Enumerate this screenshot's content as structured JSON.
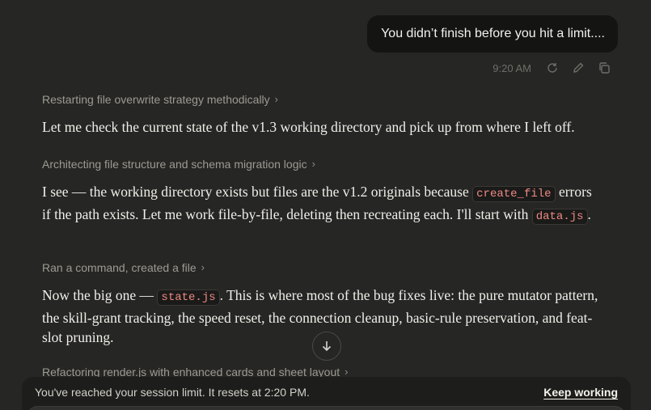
{
  "user_message": {
    "text": "You didn’t finish before you hit a limit....",
    "time": "9:20 AM",
    "actions": [
      "retry-icon",
      "edit-icon",
      "copy-icon"
    ]
  },
  "assistant": {
    "thought_1": "Restarting file overwrite strategy methodically",
    "para_1": "Let me check the current state of the v1.3 working directory and pick up from where I left off.",
    "thought_2": "Architecting file structure and schema migration logic",
    "para_2": {
      "a": "I see — the working directory exists but files are the v1.2 originals because ",
      "code1": "create_file",
      "b": " errors if the path exists. Let me work file-by-file, deleting then recreating each. I'll start with ",
      "code2": "data.js",
      "c": "."
    },
    "thought_3": "Ran a command, created a file",
    "para_3": {
      "a": "Now the big one — ",
      "code1": "state.js",
      "b": ". This is where most of the bug fixes live: the pure mutator pattern, the skill-grant tracking, the speed reset, the connection cleanup, basic-rule preservation, and feat-slot pruning."
    },
    "thought_4": "Refactoring render.js with enhanced cards and sheet layout"
  },
  "limit_bar": {
    "message": "You've reached your session limit. It resets at 2:20 PM.",
    "action": "Keep working"
  },
  "chevron": "›"
}
